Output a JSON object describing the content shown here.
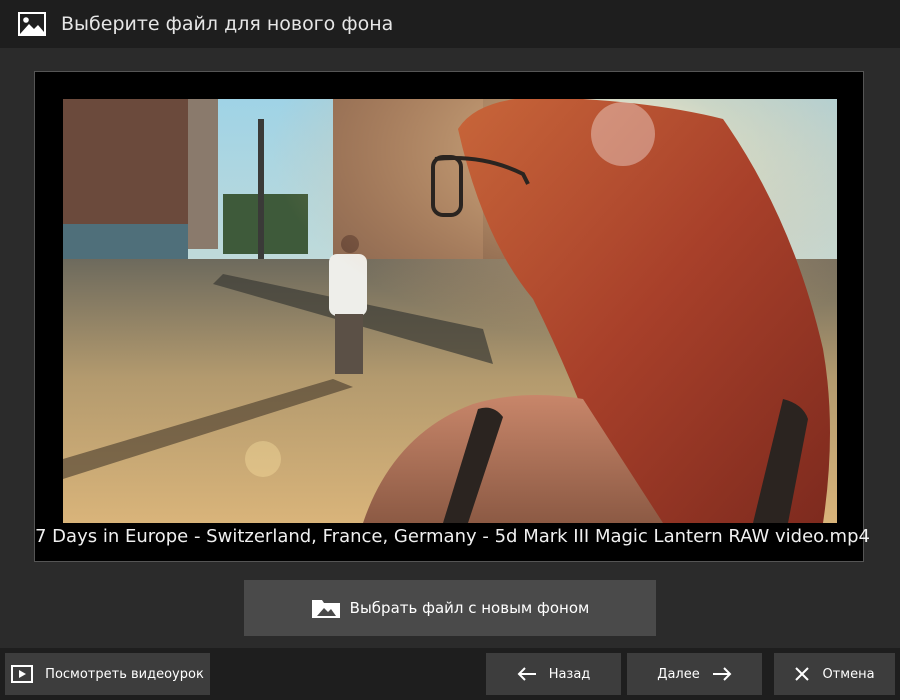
{
  "window": {
    "title": "Выберите файл для нового фона",
    "title_icon": "image-icon"
  },
  "preview": {
    "filename": "7 Days in Europe - Switzerland, France, Germany - 5d Mark III Magic Lantern RAW video.mp4"
  },
  "actions": {
    "choose_file_label": "Выбрать файл с новым фоном",
    "choose_file_icon": "folder-image-icon"
  },
  "footer": {
    "tutorial_label": "Посмотреть видеоурок",
    "back_label": "Назад",
    "next_label": "Далее",
    "cancel_label": "Отмена"
  },
  "colors": {
    "titlebar": "#1e1e1e",
    "background": "#2b2b2b",
    "button": "#3d3d3d",
    "primary_button": "#4a4a4a"
  }
}
